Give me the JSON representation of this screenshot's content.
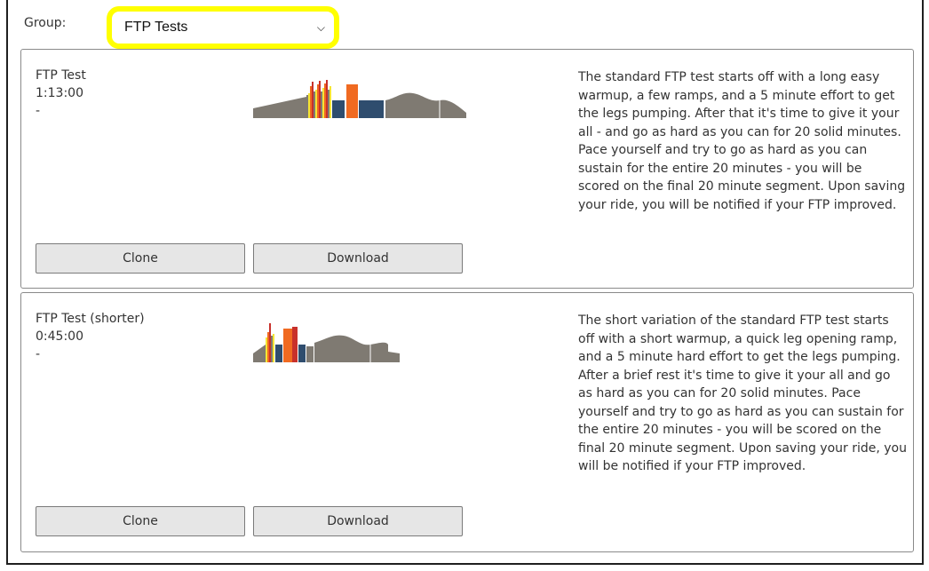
{
  "filter": {
    "label": "Group:",
    "selected": "FTP Tests",
    "highlight_color": "#ffff00"
  },
  "colors": {
    "zone_grey": "#7f7a72",
    "zone_yellow": "#f5e634",
    "zone_orange": "#f06a21",
    "zone_red": "#c8312b",
    "zone_blue": "#2f4d6e"
  },
  "workouts": [
    {
      "name": "FTP Test",
      "duration": "1:13:00",
      "extra": "-",
      "description": "The standard FTP test starts off with a long easy warmup, a few ramps, and a 5 minute effort to get the legs pumping. After that it's time to give it your all - and go as hard as you can for 20 solid minutes. Pace yourself and try to go as hard as you can sustain for the entire 20 minutes - you will be scored on the final 20 minute segment. Upon saving your ride, you will be notified if your FTP improved.",
      "clone_label": "Clone",
      "download_label": "Download"
    },
    {
      "name": "FTP Test (shorter)",
      "duration": "0:45:00",
      "extra": "-",
      "description": "The short variation of the standard FTP test starts off with a short warmup, a quick leg opening ramp, and a 5 minute hard effort to get the legs pumping. After a brief rest it's time to give it your all and go as hard as you can for 20 solid minutes. Pace yourself and try to go as hard as you can sustain for the entire 20 minutes - you will be scored on the final 20 minute segment. Upon saving your ride, you will be notified if your FTP improved.",
      "clone_label": "Clone",
      "download_label": "Download"
    }
  ]
}
